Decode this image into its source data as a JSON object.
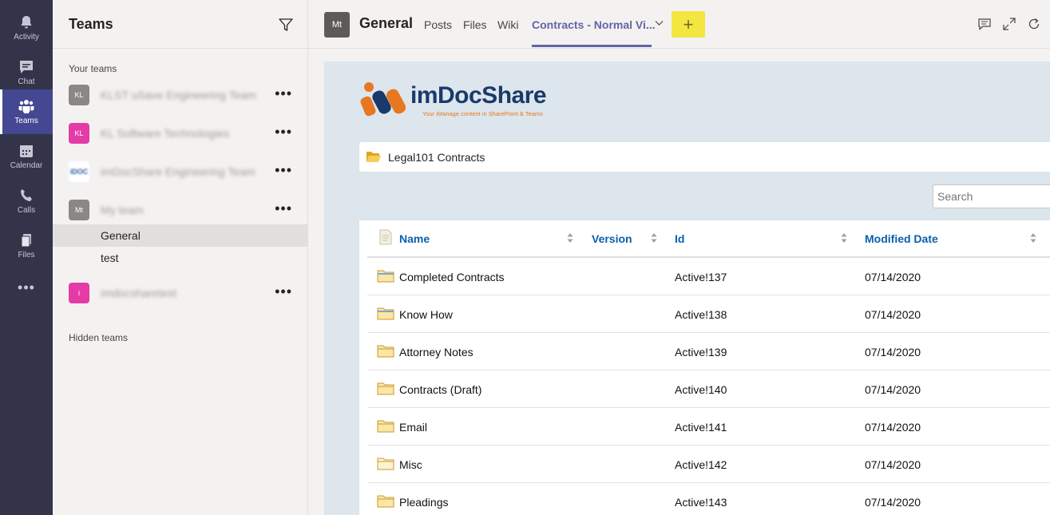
{
  "rail": {
    "items": [
      {
        "label": "Activity",
        "icon": "bell-icon"
      },
      {
        "label": "Chat",
        "icon": "chat-icon"
      },
      {
        "label": "Teams",
        "icon": "teams-icon"
      },
      {
        "label": "Calendar",
        "icon": "calendar-icon"
      },
      {
        "label": "Calls",
        "icon": "phone-icon"
      },
      {
        "label": "Files",
        "icon": "files-icon"
      }
    ],
    "more": "•••"
  },
  "teams_panel": {
    "title": "Teams",
    "your_teams_label": "Your teams",
    "hidden_teams_label": "Hidden teams",
    "teams": [
      {
        "initials": "KL",
        "name": "KLST uSave Engineering Team",
        "color": "#8a8886"
      },
      {
        "initials": "KL",
        "name": "KL Software Technologies",
        "color": "#e43ba6"
      },
      {
        "initials": "iDOC",
        "name": "imDocShare Engineering Team",
        "color": "#ffffff"
      },
      {
        "initials": "Mt",
        "name": "My team",
        "color": "#8a8886"
      },
      {
        "initials": "i",
        "name": "imdocsharetest",
        "color": "#e43ba6"
      }
    ],
    "channels": [
      "General",
      "test"
    ]
  },
  "header": {
    "avatar": "Mt",
    "title": "General",
    "tabs": [
      "Posts",
      "Files",
      "Wiki",
      "Contracts - Normal Vi..."
    ],
    "add": "+"
  },
  "content": {
    "logo_word": "imDocShare",
    "logo_tagline": "Your iManage content in SharePoint & Teams",
    "breadcrumb": "Legal101 Contracts",
    "search_placeholder": "Search",
    "columns": [
      "Name",
      "Version",
      "Id",
      "Modified Date"
    ],
    "rows": [
      {
        "name": "Completed Contracts",
        "version": "",
        "id": "Active!137",
        "date": "07/14/2020"
      },
      {
        "name": "Know How",
        "version": "",
        "id": "Active!138",
        "date": "07/14/2020"
      },
      {
        "name": "Attorney Notes",
        "version": "",
        "id": "Active!139",
        "date": "07/14/2020"
      },
      {
        "name": "Contracts (Draft)",
        "version": "",
        "id": "Active!140",
        "date": "07/14/2020"
      },
      {
        "name": "Email",
        "version": "",
        "id": "Active!141",
        "date": "07/14/2020"
      },
      {
        "name": "Misc",
        "version": "",
        "id": "Active!142",
        "date": "07/14/2020"
      },
      {
        "name": "Pleadings",
        "version": "",
        "id": "Active!143",
        "date": "07/14/2020"
      }
    ]
  },
  "colors": {
    "rail_bg": "#33344a",
    "accent": "#6264a7",
    "link_blue": "#0a5fab",
    "add_button": "#f4e640"
  }
}
